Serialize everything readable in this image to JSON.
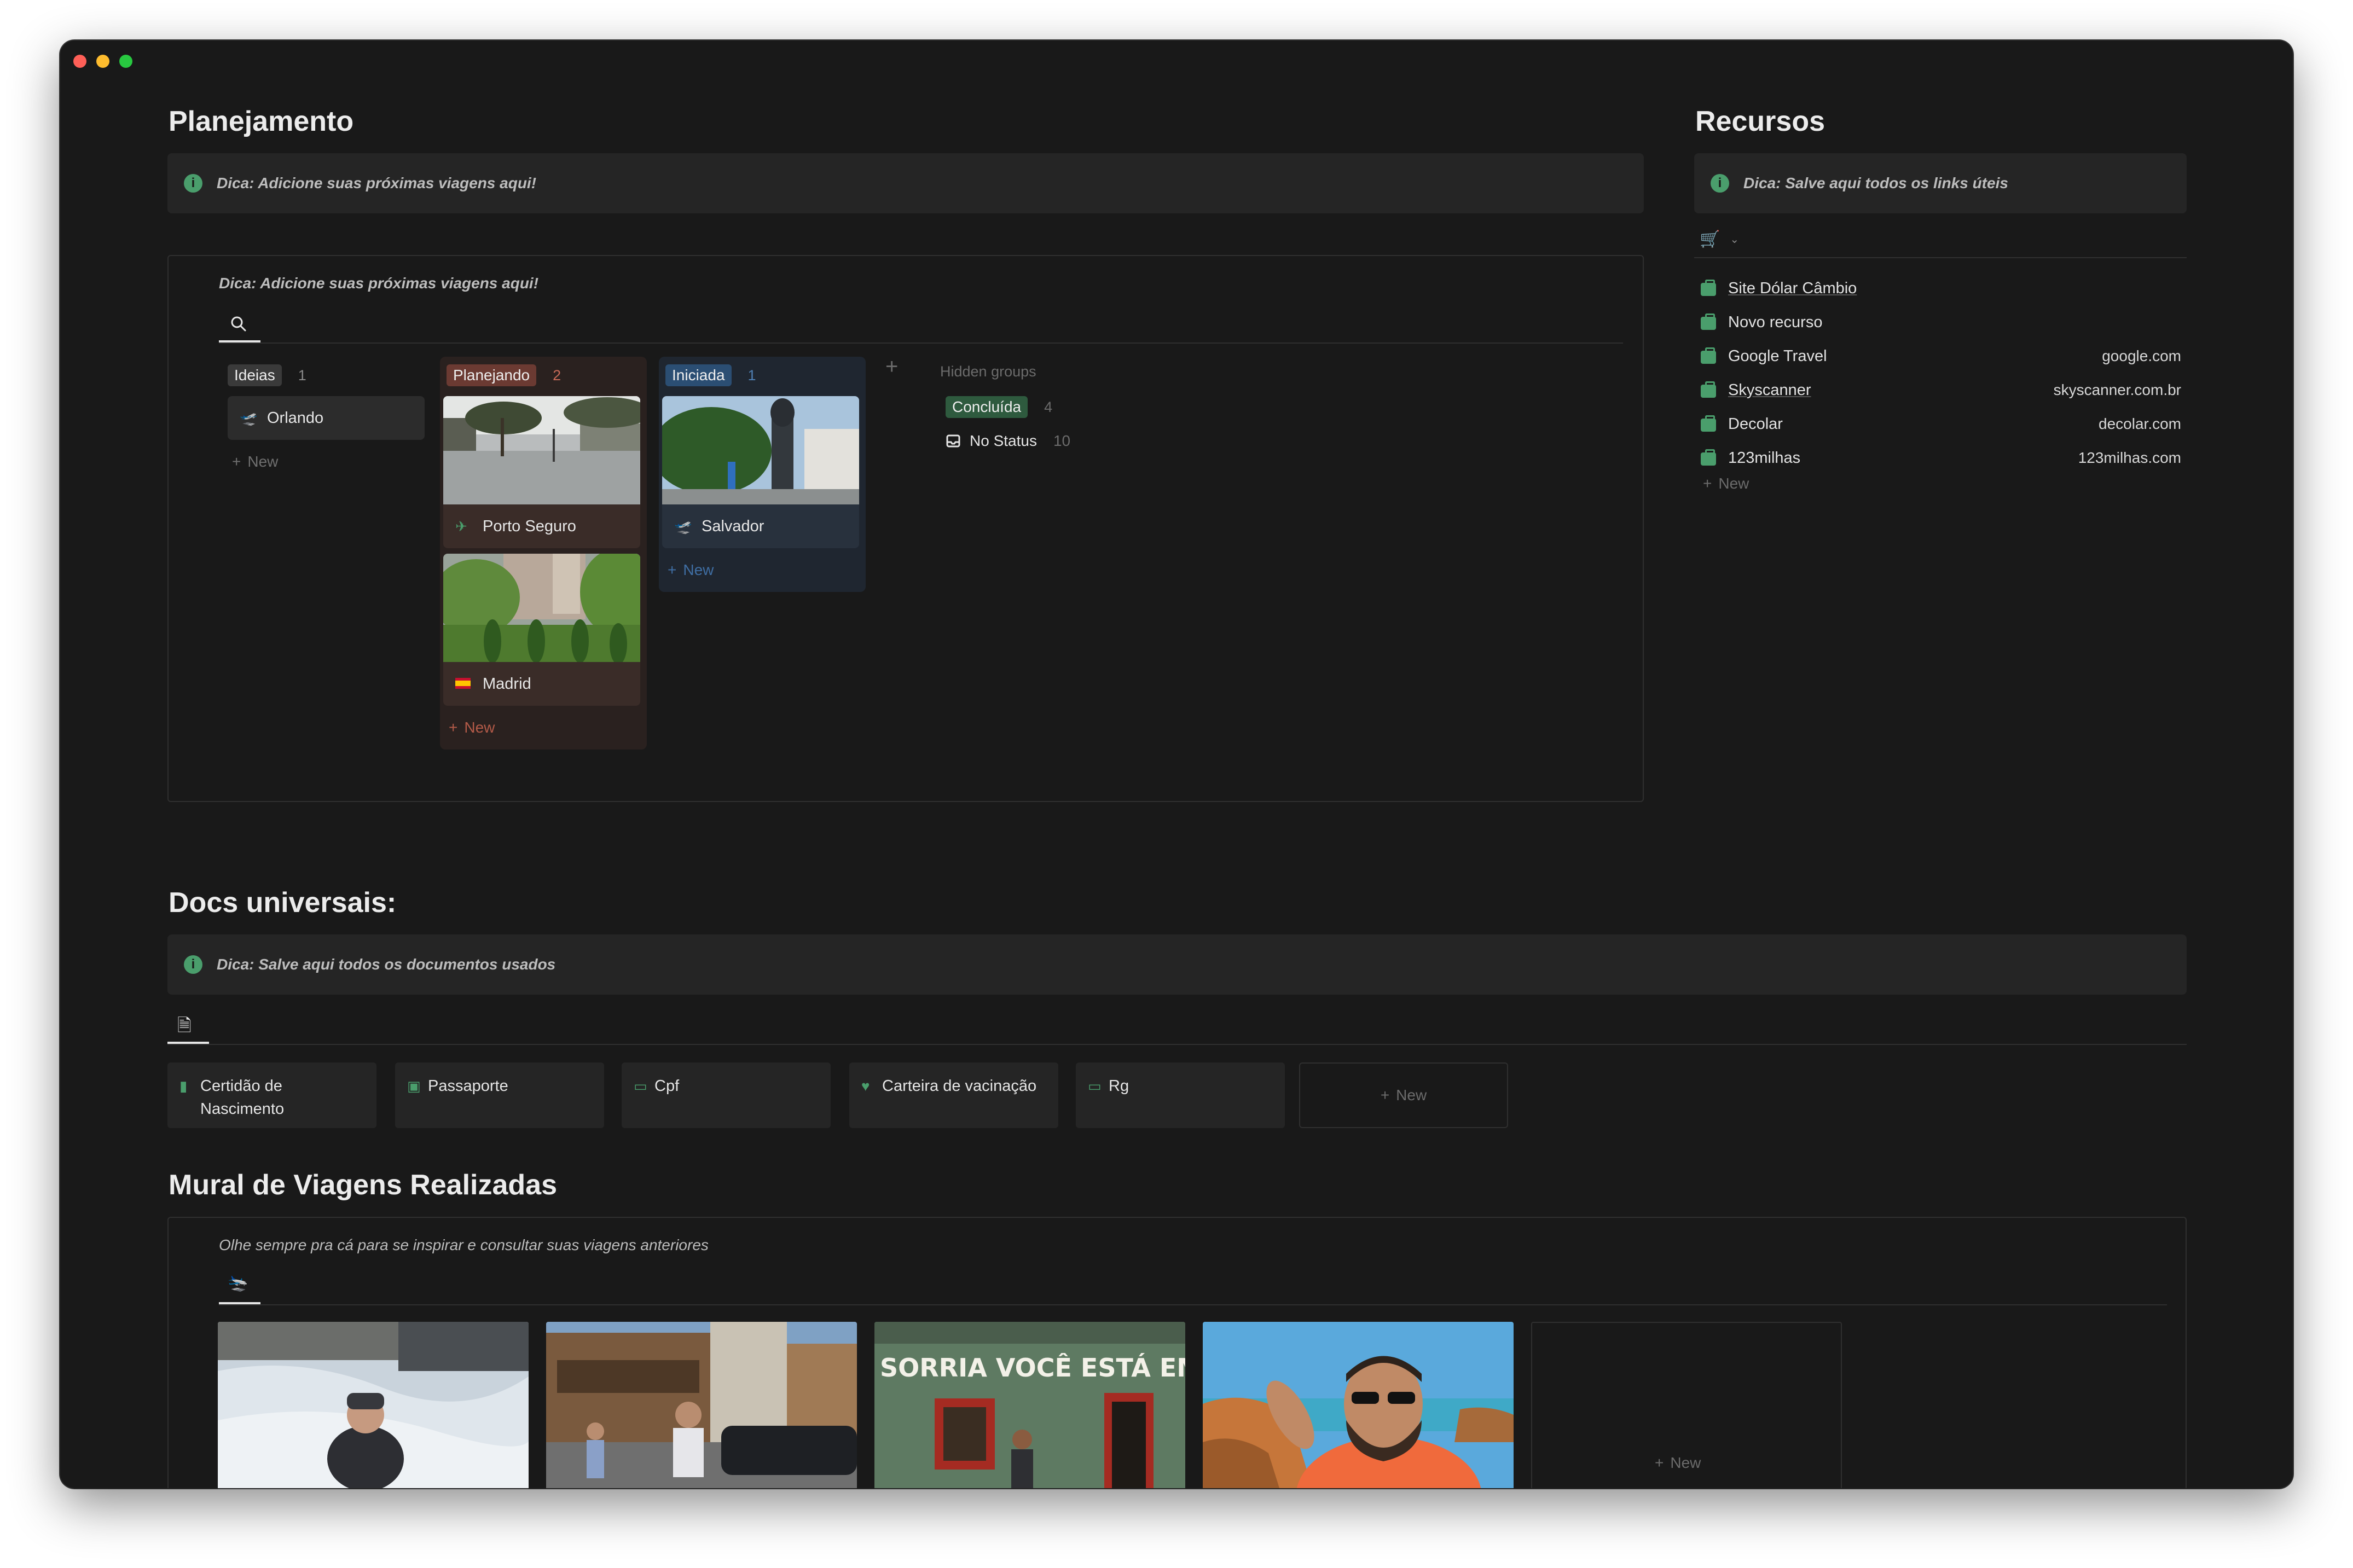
{
  "planejamento": {
    "title": "Planejamento",
    "tip": "Dica: Adicione suas próximas viagens aqui!",
    "board_note": "Dica: Adicione suas próximas viagens aqui!",
    "columns": [
      {
        "tag": "Ideias",
        "count": "1",
        "tag_color": "#3a3a3a",
        "cards": [
          {
            "title": "Orlando",
            "icon": "airplane-departure-icon"
          }
        ],
        "new_label": "New"
      },
      {
        "tag": "Planejando",
        "count": "2",
        "tag_color": "#6b3a32",
        "cards": [
          {
            "title": "Porto Seguro",
            "icon": "airplane-icon"
          },
          {
            "title": "Madrid",
            "icon": "spain-flag-icon"
          }
        ],
        "new_label": "New"
      },
      {
        "tag": "Iniciada",
        "count": "1",
        "tag_color": "#2b4e73",
        "cards": [
          {
            "title": "Salvador",
            "icon": "airplane-departure-icon"
          }
        ],
        "new_label": "New"
      }
    ],
    "hidden_groups_label": "Hidden groups",
    "hidden_groups": [
      {
        "tag": "Concluída",
        "count": "4",
        "tag_color": "#2e5a3e"
      },
      {
        "label": "No Status",
        "count": "10"
      }
    ]
  },
  "recursos": {
    "title": "Recursos",
    "tip": "Dica: Salve aqui todos os links úteis",
    "items": [
      {
        "name": "Site Dólar Câmbio",
        "url": ""
      },
      {
        "name": "Novo recurso",
        "url": ""
      },
      {
        "name": "Google Travel",
        "url": "google.com"
      },
      {
        "name": "Skyscanner",
        "url": "skyscanner.com.br"
      },
      {
        "name": "Decolar",
        "url": "decolar.com"
      },
      {
        "name": "123milhas",
        "url": "123milhas.com"
      }
    ],
    "new_label": "New"
  },
  "docs": {
    "title": "Docs universais:",
    "tip": "Dica: Salve aqui todos os documentos usados",
    "items": [
      {
        "line1": "Certidão de",
        "line2": "Nascimento",
        "icon": "document-icon"
      },
      {
        "line1": "Passaporte",
        "line2": "",
        "icon": "passport-icon"
      },
      {
        "line1": "Cpf",
        "line2": "",
        "icon": "id-card-icon"
      },
      {
        "line1": "Carteira de vacinação",
        "line2": "",
        "icon": "heart-icon"
      },
      {
        "line1": "Rg",
        "line2": "",
        "icon": "id-card-icon"
      }
    ],
    "new_label": "New"
  },
  "mural": {
    "title": "Mural de Viagens Realizadas",
    "note": "Olhe sempre pra cá para se inspirar e consultar suas viagens anteriores",
    "new_label": "New",
    "photo3_text": "SORRIA VOCÊ ESTÁ EM CARAÍVA"
  }
}
